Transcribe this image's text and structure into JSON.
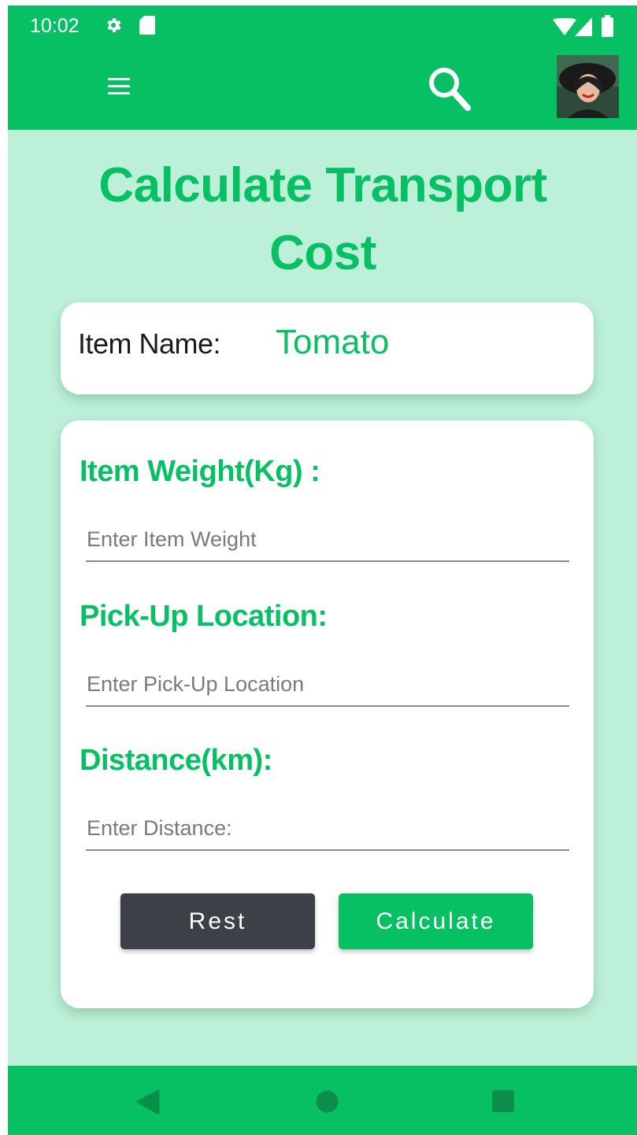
{
  "status_bar": {
    "time": "10:02",
    "icons": [
      "gear-icon",
      "sd-card-icon",
      "wifi-icon",
      "cell-signal-icon",
      "battery-icon"
    ]
  },
  "app_bar": {
    "menu_icon": "hamburger-icon",
    "search_icon": "search-icon",
    "avatar": "profile-avatar"
  },
  "page": {
    "title": "Calculate Transport Cost"
  },
  "item_card": {
    "label": "Item Name:",
    "value": "Tomato"
  },
  "form": {
    "weight_label": "Item Weight(Kg) :",
    "weight_placeholder": "Enter Item Weight",
    "pickup_label": "Pick-Up Location:",
    "pickup_placeholder": "Enter Pick-Up Location",
    "distance_label": "Distance(km):",
    "distance_placeholder": "Enter Distance:",
    "reset_label": "Rest",
    "calculate_label": "Calculate"
  },
  "nav_bar": {
    "icons": [
      "back-icon",
      "home-icon",
      "recents-icon"
    ]
  },
  "colors": {
    "primary": "#08c064",
    "background": "#bcf0d8",
    "dark_button": "#3d4147"
  }
}
